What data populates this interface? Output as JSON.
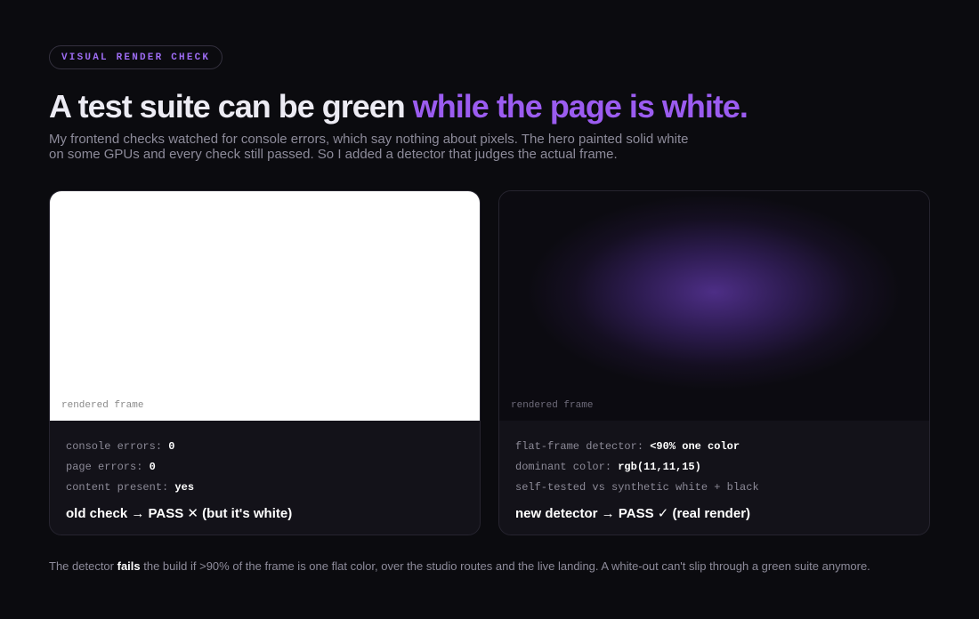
{
  "badge": "VISUAL RENDER CHECK",
  "headline": {
    "plain": "A test suite can be green ",
    "accent": "while the page is white."
  },
  "subtitle": "My frontend checks watched for console errors, which say nothing about pixels. The hero painted solid white on some GPUs and every check still passed. So I added a detector that judges the actual frame.",
  "left_card": {
    "frame_label": "rendered frame",
    "stats": [
      {
        "label": "console errors: ",
        "value": "0"
      },
      {
        "label": "page errors: ",
        "value": "0"
      },
      {
        "label": "content present: ",
        "value": "yes"
      }
    ],
    "verdict": "old check → PASS ✕ (but it's white)"
  },
  "right_card": {
    "frame_label": "rendered frame",
    "stats": [
      {
        "label": "flat-frame detector: ",
        "value": "<90% one color"
      },
      {
        "label": "dominant color: ",
        "value": "rgb(11,11,15)"
      },
      {
        "label": "self-tested vs synthetic white + black",
        "value": ""
      }
    ],
    "verdict": "new detector → PASS ✓ (real render)"
  },
  "footer": {
    "before": "The detector ",
    "strong": "fails",
    "after": " the build if >90% of the frame is one flat color, over the studio routes and the live landing. A white-out can't slip through a green suite anymore."
  },
  "colors": {
    "background": "#0b0b0f",
    "accent": "#9b5cf0",
    "card": "#131219",
    "white_frame": "#ffffff"
  }
}
